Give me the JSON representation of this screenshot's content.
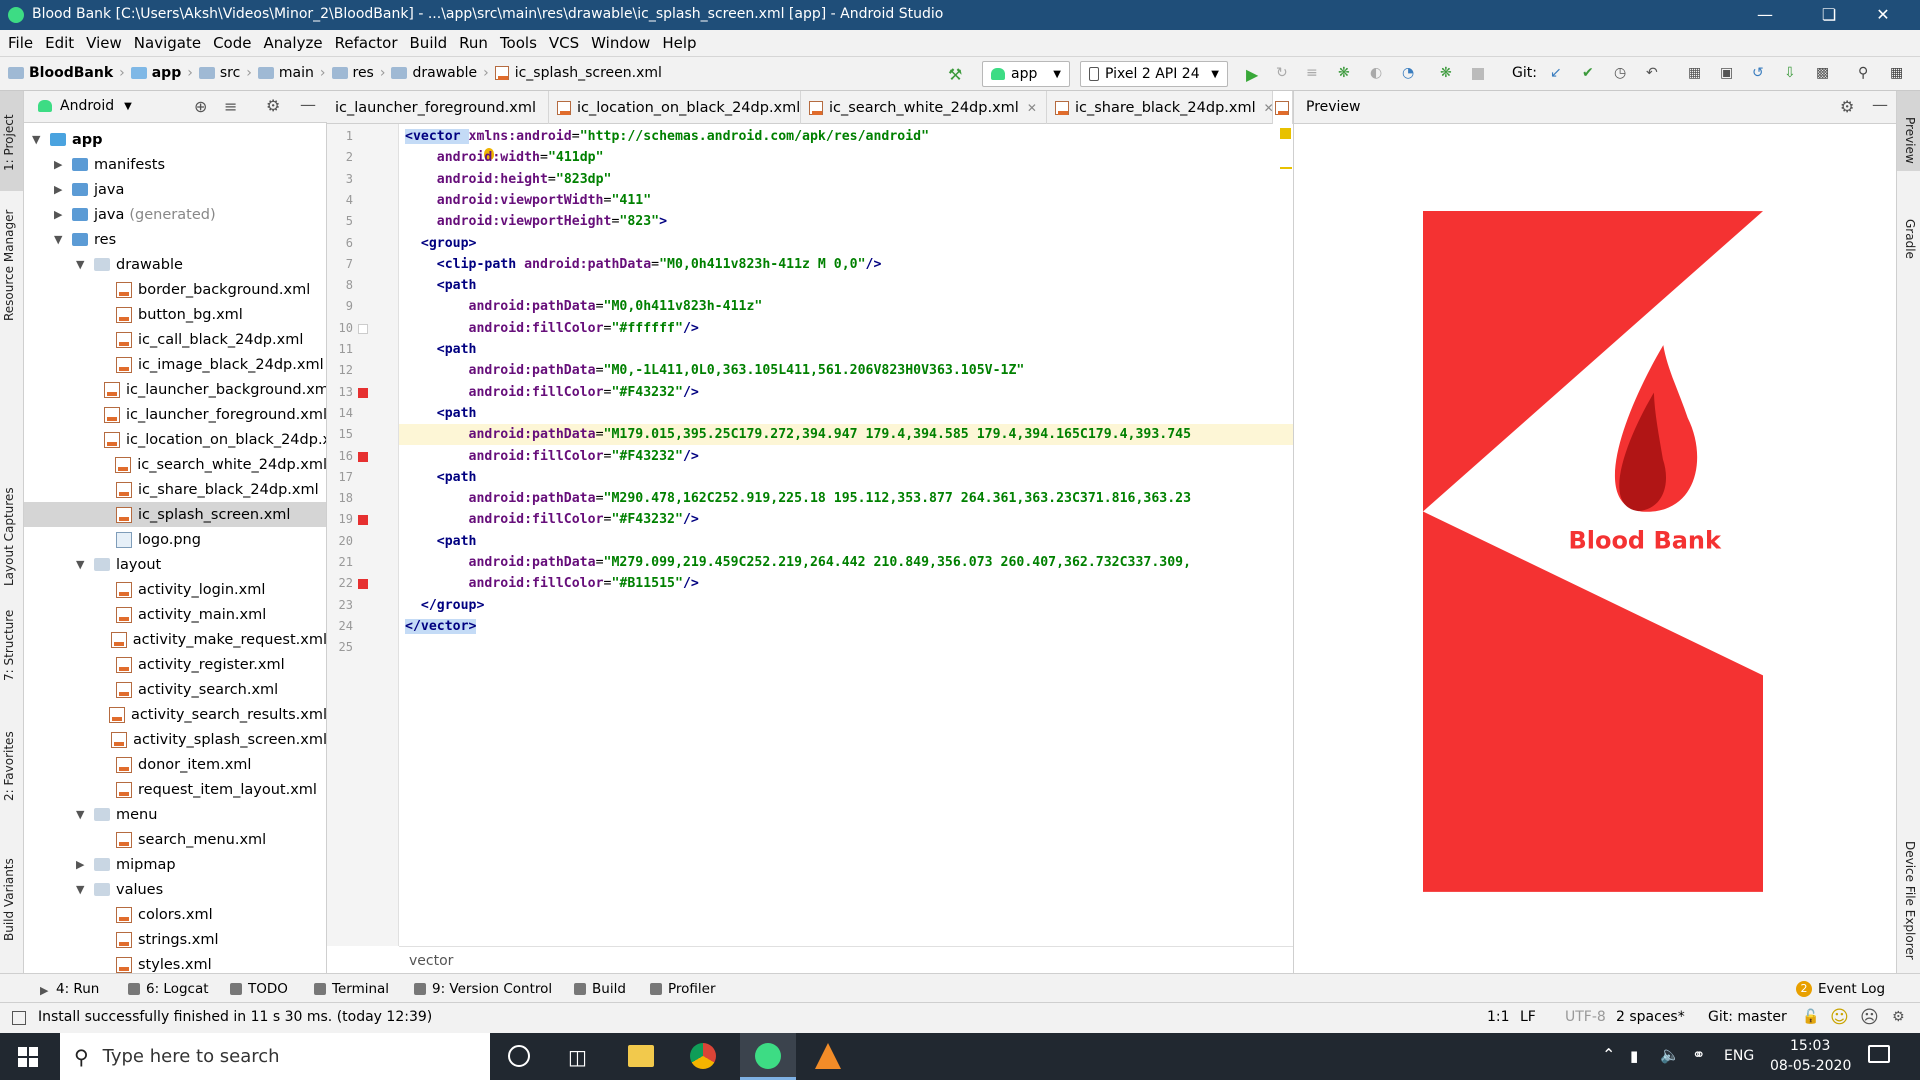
{
  "window": {
    "title": "Blood Bank [C:\\Users\\Aksh\\Videos\\Minor_2\\BloodBank] - ...\\app\\src\\main\\res\\drawable\\ic_splash_screen.xml [app] - Android Studio"
  },
  "menu": [
    "File",
    "Edit",
    "View",
    "Navigate",
    "Code",
    "Analyze",
    "Refactor",
    "Build",
    "Run",
    "Tools",
    "VCS",
    "Window",
    "Help"
  ],
  "breadcrumbs": [
    "BloodBank",
    "app",
    "src",
    "main",
    "res",
    "drawable",
    "ic_splash_screen.xml"
  ],
  "toolbar": {
    "run_config": "app",
    "device": "Pixel 2 API 24",
    "git_label": "Git:"
  },
  "project": {
    "view_mode": "Android",
    "tree": [
      {
        "label": "app",
        "level": 0,
        "type": "module",
        "expanded": true
      },
      {
        "label": "manifests",
        "level": 1,
        "type": "folder",
        "expanded": false
      },
      {
        "label": "java",
        "level": 1,
        "type": "folder",
        "expanded": false
      },
      {
        "label": "java",
        "suffix": "(generated)",
        "level": 1,
        "type": "folder-gen",
        "expanded": false
      },
      {
        "label": "res",
        "level": 1,
        "type": "folder",
        "expanded": true
      },
      {
        "label": "drawable",
        "level": 2,
        "type": "resfolder",
        "expanded": true
      },
      {
        "label": "border_background.xml",
        "level": 3,
        "type": "xml"
      },
      {
        "label": "button_bg.xml",
        "level": 3,
        "type": "xml"
      },
      {
        "label": "ic_call_black_24dp.xml",
        "level": 3,
        "type": "xml"
      },
      {
        "label": "ic_image_black_24dp.xml",
        "level": 3,
        "type": "xml"
      },
      {
        "label": "ic_launcher_background.xm",
        "level": 3,
        "type": "xml"
      },
      {
        "label": "ic_launcher_foreground.xml",
        "level": 3,
        "type": "xml"
      },
      {
        "label": "ic_location_on_black_24dp.x",
        "level": 3,
        "type": "xml"
      },
      {
        "label": "ic_search_white_24dp.xml",
        "level": 3,
        "type": "xml"
      },
      {
        "label": "ic_share_black_24dp.xml",
        "level": 3,
        "type": "xml"
      },
      {
        "label": "ic_splash_screen.xml",
        "level": 3,
        "type": "xml",
        "selected": true
      },
      {
        "label": "logo.png",
        "level": 3,
        "type": "png"
      },
      {
        "label": "layout",
        "level": 2,
        "type": "resfolder",
        "expanded": true
      },
      {
        "label": "activity_login.xml",
        "level": 3,
        "type": "xml"
      },
      {
        "label": "activity_main.xml",
        "level": 3,
        "type": "xml"
      },
      {
        "label": "activity_make_request.xml",
        "level": 3,
        "type": "xml"
      },
      {
        "label": "activity_register.xml",
        "level": 3,
        "type": "xml"
      },
      {
        "label": "activity_search.xml",
        "level": 3,
        "type": "xml"
      },
      {
        "label": "activity_search_results.xml",
        "level": 3,
        "type": "xml"
      },
      {
        "label": "activity_splash_screen.xml",
        "level": 3,
        "type": "xml"
      },
      {
        "label": "donor_item.xml",
        "level": 3,
        "type": "xml"
      },
      {
        "label": "request_item_layout.xml",
        "level": 3,
        "type": "xml"
      },
      {
        "label": "menu",
        "level": 2,
        "type": "resfolder",
        "expanded": true
      },
      {
        "label": "search_menu.xml",
        "level": 3,
        "type": "xml"
      },
      {
        "label": "mipmap",
        "level": 2,
        "type": "resfolder",
        "expanded": false
      },
      {
        "label": "values",
        "level": 2,
        "type": "resfolder",
        "expanded": true
      },
      {
        "label": "colors.xml",
        "level": 3,
        "type": "xml"
      },
      {
        "label": "strings.xml",
        "level": 3,
        "type": "xml"
      },
      {
        "label": "styles.xml",
        "level": 3,
        "type": "xml"
      }
    ]
  },
  "left_stripe": [
    "1: Project",
    "Resource Manager",
    "Layout Captures",
    "7: Structure",
    "2: Favorites",
    "Build Variants"
  ],
  "right_stripe": [
    "Preview",
    "Gradle",
    "Device File Explorer"
  ],
  "editor_tabs": [
    {
      "label": "ic_launcher_foreground.xml",
      "active": false
    },
    {
      "label": "ic_location_on_black_24dp.xml",
      "active": false
    },
    {
      "label": "ic_search_white_24dp.xml",
      "active": false
    },
    {
      "label": "ic_share_black_24dp.xml",
      "active": false
    }
  ],
  "line_numbers": [
    "1",
    "2",
    "3",
    "4",
    "5",
    "6",
    "7",
    "8",
    "9",
    "10",
    "11",
    "12",
    "13",
    "14",
    "15",
    "16",
    "17",
    "18",
    "19",
    "20",
    "21",
    "22",
    "23",
    "24",
    "25"
  ],
  "code_lines": [
    [
      [
        "tag",
        "<vector "
      ],
      [
        "an",
        "xmlns:android"
      ],
      [
        "pn",
        "="
      ],
      [
        "av",
        "\"http://schemas.android.com/apk/res/android\""
      ]
    ],
    [
      [
        "pn",
        "    "
      ],
      [
        "an",
        "android:width"
      ],
      [
        "pn",
        "="
      ],
      [
        "av",
        "\"411dp\""
      ]
    ],
    [
      [
        "pn",
        "    "
      ],
      [
        "an",
        "android:height"
      ],
      [
        "pn",
        "="
      ],
      [
        "av",
        "\"823dp\""
      ]
    ],
    [
      [
        "pn",
        "    "
      ],
      [
        "an",
        "android:viewportWidth"
      ],
      [
        "pn",
        "="
      ],
      [
        "av",
        "\"411\""
      ]
    ],
    [
      [
        "pn",
        "    "
      ],
      [
        "an",
        "android:viewportHeight"
      ],
      [
        "pn",
        "="
      ],
      [
        "av",
        "\"823\""
      ],
      [
        "tag",
        ">"
      ]
    ],
    [
      [
        "pn",
        "  "
      ],
      [
        "tag",
        "<group>"
      ]
    ],
    [
      [
        "pn",
        "    "
      ],
      [
        "tag",
        "<clip-path "
      ],
      [
        "an",
        "android:pathData"
      ],
      [
        "pn",
        "="
      ],
      [
        "av",
        "\"M0,0h411v823h-411z M 0,0\""
      ],
      [
        "tag",
        "/>"
      ]
    ],
    [
      [
        "pn",
        "    "
      ],
      [
        "tag",
        "<path"
      ]
    ],
    [
      [
        "pn",
        "        "
      ],
      [
        "an",
        "android:pathData"
      ],
      [
        "pn",
        "="
      ],
      [
        "av",
        "\"M0,0h411v823h-411z\""
      ]
    ],
    [
      [
        "pn",
        "        "
      ],
      [
        "an",
        "android:fillColor"
      ],
      [
        "pn",
        "="
      ],
      [
        "av",
        "\"#ffffff\""
      ],
      [
        "tag",
        "/>"
      ]
    ],
    [
      [
        "pn",
        "    "
      ],
      [
        "tag",
        "<path"
      ]
    ],
    [
      [
        "pn",
        "        "
      ],
      [
        "an",
        "android:pathData"
      ],
      [
        "pn",
        "="
      ],
      [
        "av",
        "\"M0,-1L411,0L0,363.105L411,561.206V823H0V363.105V-1Z\""
      ]
    ],
    [
      [
        "pn",
        "        "
      ],
      [
        "an",
        "android:fillColor"
      ],
      [
        "pn",
        "="
      ],
      [
        "av",
        "\"#F43232\""
      ],
      [
        "tag",
        "/>"
      ]
    ],
    [
      [
        "pn",
        "    "
      ],
      [
        "tag",
        "<path"
      ]
    ],
    [
      [
        "pn",
        "        "
      ],
      [
        "an",
        "android:pathData"
      ],
      [
        "pn",
        "="
      ],
      [
        "av",
        "\"M179.015,395.25C179.272,394.947 179.4,394.585 179.4,394.165C179.4,393.745"
      ]
    ],
    [
      [
        "pn",
        "        "
      ],
      [
        "an",
        "android:fillColor"
      ],
      [
        "pn",
        "="
      ],
      [
        "av",
        "\"#F43232\""
      ],
      [
        "tag",
        "/>"
      ]
    ],
    [
      [
        "pn",
        "    "
      ],
      [
        "tag",
        "<path"
      ]
    ],
    [
      [
        "pn",
        "        "
      ],
      [
        "an",
        "android:pathData"
      ],
      [
        "pn",
        "="
      ],
      [
        "av",
        "\"M290.478,162C252.919,225.18 195.112,353.877 264.361,363.23C371.816,363.23"
      ]
    ],
    [
      [
        "pn",
        "        "
      ],
      [
        "an",
        "android:fillColor"
      ],
      [
        "pn",
        "="
      ],
      [
        "av",
        "\"#F43232\""
      ],
      [
        "tag",
        "/>"
      ]
    ],
    [
      [
        "pn",
        "    "
      ],
      [
        "tag",
        "<path"
      ]
    ],
    [
      [
        "pn",
        "        "
      ],
      [
        "an",
        "android:pathData"
      ],
      [
        "pn",
        "="
      ],
      [
        "av",
        "\"M279.099,219.459C252.219,264.442 210.849,356.073 260.407,362.732C337.309,"
      ]
    ],
    [
      [
        "pn",
        "        "
      ],
      [
        "an",
        "android:fillColor"
      ],
      [
        "pn",
        "="
      ],
      [
        "av",
        "\"#B11515\""
      ],
      [
        "tag",
        "/>"
      ]
    ],
    [
      [
        "pn",
        "  "
      ],
      [
        "tag",
        "</group>"
      ]
    ],
    [
      [
        "tag",
        "</vector>"
      ]
    ],
    [
      [
        "pn",
        ""
      ]
    ]
  ],
  "editor_footer": "vector",
  "preview": {
    "title": "Preview",
    "logo_text": "Blood Bank",
    "colors": {
      "red": "#F43232",
      "dark_red": "#B11515",
      "white": "#ffffff"
    }
  },
  "tool_tabs": [
    "4: Run",
    "6: Logcat",
    "TODO",
    "Terminal",
    "9: Version Control",
    "Build",
    "Profiler"
  ],
  "event_log": {
    "count": "2",
    "label": "Event Log"
  },
  "status": {
    "message": "Install successfully finished in 11 s 30 ms. (today 12:39)",
    "position": "1:1",
    "line_sep": "LF",
    "encoding": "UTF-8",
    "indent": "2 spaces*",
    "git": "Git: master"
  },
  "taskbar": {
    "search_placeholder": "Type here to search",
    "language": "ENG",
    "time": "15:03",
    "date": "08-05-2020"
  }
}
